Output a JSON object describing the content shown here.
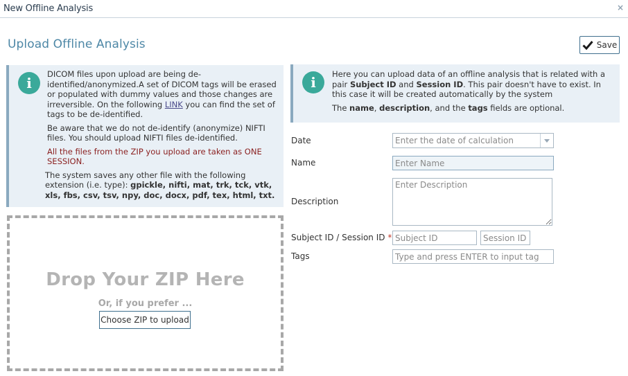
{
  "window": {
    "title": "New Offline Analysis",
    "close_glyph": "×"
  },
  "page": {
    "heading": "Upload Offline Analysis"
  },
  "toolbar": {
    "save_label": "Save",
    "save_icon": "checkmark-icon"
  },
  "info_left": {
    "icon": "info-icon",
    "icon_glyph": "i",
    "p1_a": "DICOM files upon upload are being de-identified/anonymized.A set of DICOM tags will be erased or populated with dummy values and those changes are irreversible. On the following ",
    "p1_link": "LINK",
    "p1_b": " you can find the set of tags to be de-identified.",
    "p2": "Be aware that we do not de-identify (anonymize) NIFTI files. You should upload NIFTI files de-identified.",
    "p3": "All the files from the ZIP you upload are taken as ONE SESSION.",
    "p4_a": "The system saves any other file with the following extension (i.e. type): ",
    "p4_ext": "gpickle, nifti, mat, trk, tck, vtk, xls, fbs, csv, tsv, npy, doc, docx, pdf, tex, html, txt."
  },
  "info_right": {
    "icon": "info-icon",
    "icon_glyph": "i",
    "p1_a": "Here you can upload data of an offline analysis that is related with a pair ",
    "p1_subject": "Subject ID",
    "p1_and": " and ",
    "p1_session": "Session ID",
    "p1_b": ". This pair doesn't have to exist. In this case it will be created automatically by the system",
    "p2_a": "The ",
    "p2_name": "name",
    "p2_c1": ", ",
    "p2_desc": "description",
    "p2_c2": ", and the ",
    "p2_tags": "tags",
    "p2_b": " fields are optional."
  },
  "dropzone": {
    "title": "Drop Your ZIP Here",
    "subtitle": "Or, if you prefer ...",
    "button_label": "Choose ZIP to upload"
  },
  "form": {
    "date": {
      "label": "Date",
      "placeholder": "Enter the date of calculation",
      "value": ""
    },
    "name": {
      "label": "Name",
      "placeholder": "Enter Name",
      "value": ""
    },
    "description": {
      "label": "Description",
      "placeholder": "Enter Description",
      "value": ""
    },
    "subject_session": {
      "label": "Subject ID / Session ID",
      "required_mark": "*",
      "subject_placeholder": "Subject ID",
      "session_placeholder": "Session ID"
    },
    "tags": {
      "label": "Tags",
      "placeholder": "Type and press ENTER to input tag"
    }
  },
  "colors": {
    "accent": "#4d87a6",
    "info_bg": "#e9f0f6",
    "badge": "#3aa99a",
    "warning_text": "#8a1f1f"
  }
}
